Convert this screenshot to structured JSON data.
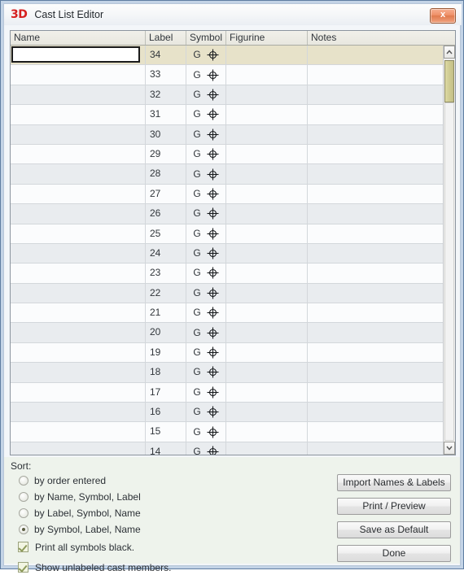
{
  "window": {
    "logo": "3D",
    "title": "Cast List Editor",
    "close_label": "x",
    "close_icon": "close-icon"
  },
  "grid": {
    "columns": [
      "Name",
      "Label",
      "Symbol",
      "Figurine",
      "Notes"
    ],
    "symbol_letter": "G",
    "symbol_icon": "crosshair-circle-icon",
    "name_input_value": "",
    "name_input_placeholder": "",
    "rows": [
      {
        "label": "34",
        "symbol": "G",
        "figurine": "",
        "notes": "",
        "selected": true
      },
      {
        "label": "33",
        "symbol": "G",
        "figurine": "",
        "notes": "",
        "selected": false
      },
      {
        "label": "32",
        "symbol": "G",
        "figurine": "",
        "notes": "",
        "selected": false
      },
      {
        "label": "31",
        "symbol": "G",
        "figurine": "",
        "notes": "",
        "selected": false
      },
      {
        "label": "30",
        "symbol": "G",
        "figurine": "",
        "notes": "",
        "selected": false
      },
      {
        "label": "29",
        "symbol": "G",
        "figurine": "",
        "notes": "",
        "selected": false
      },
      {
        "label": "28",
        "symbol": "G",
        "figurine": "",
        "notes": "",
        "selected": false
      },
      {
        "label": "27",
        "symbol": "G",
        "figurine": "",
        "notes": "",
        "selected": false
      },
      {
        "label": "26",
        "symbol": "G",
        "figurine": "",
        "notes": "",
        "selected": false
      },
      {
        "label": "25",
        "symbol": "G",
        "figurine": "",
        "notes": "",
        "selected": false
      },
      {
        "label": "24",
        "symbol": "G",
        "figurine": "",
        "notes": "",
        "selected": false
      },
      {
        "label": "23",
        "symbol": "G",
        "figurine": "",
        "notes": "",
        "selected": false
      },
      {
        "label": "22",
        "symbol": "G",
        "figurine": "",
        "notes": "",
        "selected": false
      },
      {
        "label": "21",
        "symbol": "G",
        "figurine": "",
        "notes": "",
        "selected": false
      },
      {
        "label": "20",
        "symbol": "G",
        "figurine": "",
        "notes": "",
        "selected": false
      },
      {
        "label": "19",
        "symbol": "G",
        "figurine": "",
        "notes": "",
        "selected": false
      },
      {
        "label": "18",
        "symbol": "G",
        "figurine": "",
        "notes": "",
        "selected": false
      },
      {
        "label": "17",
        "symbol": "G",
        "figurine": "",
        "notes": "",
        "selected": false
      },
      {
        "label": "16",
        "symbol": "G",
        "figurine": "",
        "notes": "",
        "selected": false
      },
      {
        "label": "15",
        "symbol": "G",
        "figurine": "",
        "notes": "",
        "selected": false
      },
      {
        "label": "14",
        "symbol": "G",
        "figurine": "",
        "notes": "",
        "selected": false
      }
    ]
  },
  "scrollbar": {
    "up_icon": "chevron-up-icon",
    "down_icon": "chevron-down-icon"
  },
  "sort": {
    "heading": "Sort:",
    "options": [
      {
        "label": "by order entered",
        "selected": false
      },
      {
        "label": "by Name, Symbol, Label",
        "selected": false
      },
      {
        "label": "by Label, Symbol, Name",
        "selected": false
      },
      {
        "label": "by Symbol, Label, Name",
        "selected": true
      }
    ]
  },
  "checkboxes": [
    {
      "label": "Print all symbols black.",
      "checked": true
    },
    {
      "label": "Show unlabeled cast members.",
      "checked": true
    }
  ],
  "buttons": {
    "import": "Import Names & Labels",
    "print_preview": "Print / Preview",
    "save_default": "Save as Default",
    "done": "Done"
  },
  "colors": {
    "accent_red": "#d62020",
    "selected_row": "#e7e2c9",
    "scroll_thumb": "#cfcb92",
    "close_button": "#ef9068"
  }
}
